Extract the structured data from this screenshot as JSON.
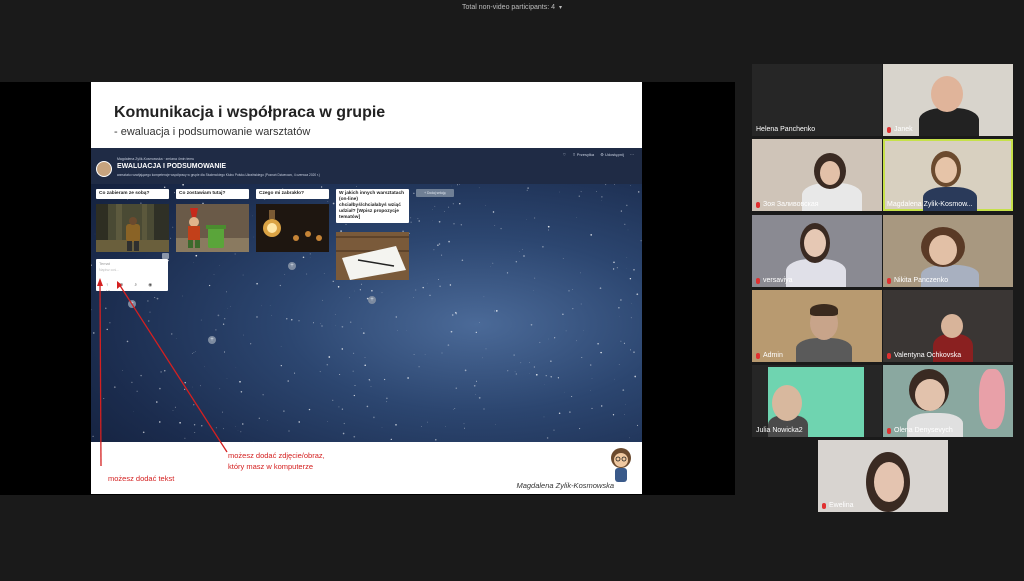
{
  "topbar": {
    "label": "Total non-video participants: 4",
    "caret": "▾"
  },
  "slide": {
    "title": "Komunikacja i współpraca w grupie",
    "subtitle": "- ewaluacja i podsumowanie warsztatów",
    "signature": "Magdalena Zylik-Kosmowska"
  },
  "padlet": {
    "author": "Magdalena Zylik-Kosmowska  ·  zmiana 4min temu",
    "title": "EWALUACJA I PODSUMOWANIE",
    "description": "warsztatu rozwijającego kompetencje współpracy w grupie dla Studenckiego Klubu Polsko-Ukraińskiego (Poznań Dziwnowo, 4 czerwca 2020 r.)",
    "icons": [
      "heart-icon",
      "share-icon",
      "settings-icon",
      "more-icon"
    ],
    "header_links": [
      "♡",
      "⇪ Przesyłka",
      "⚙ Udostępnij",
      "⋯"
    ],
    "add_column": "+ Dodaj sekcję",
    "columns": [
      {
        "heading": "Co zabieram ze sobą?"
      },
      {
        "heading": "Co zostawiam tutaj?"
      },
      {
        "heading": "Czego mi zabrakło?"
      },
      {
        "heading": "W jakich innych warsztatach (on-line) chciałbyś/chciałabyś wziąć udział? [Wpisz propozycje tematów]"
      }
    ],
    "compose": {
      "subject_placeholder": "Temat",
      "body_placeholder": "Napisz coś...",
      "tools": "↑ ⊕ ⌕ ◉ ⋯"
    }
  },
  "annotations": {
    "text_hint": "możesz dodać tekst",
    "image_hint_1": "możesz dodać zdjęcie/obraz,",
    "image_hint_2": "który masz w komputerze"
  },
  "participants": [
    {
      "name": "Helena Panchenko",
      "muted": false
    },
    {
      "name": "Janek",
      "muted": true
    },
    {
      "name": "Зоя Заливовская",
      "muted": true
    },
    {
      "name": "Magdalena Zylik-Kosmow...",
      "muted": false,
      "active": true
    },
    {
      "name": "versaviya",
      "muted": true
    },
    {
      "name": "Nikita Panczenko",
      "muted": true
    },
    {
      "name": "Admin",
      "muted": true
    },
    {
      "name": "Valentyna Ochkovska",
      "muted": true
    },
    {
      "name": "Julia Nowicka2",
      "muted": false
    },
    {
      "name": "Olena Denysevych",
      "muted": true
    },
    {
      "name": "Ewelina",
      "muted": true
    }
  ]
}
